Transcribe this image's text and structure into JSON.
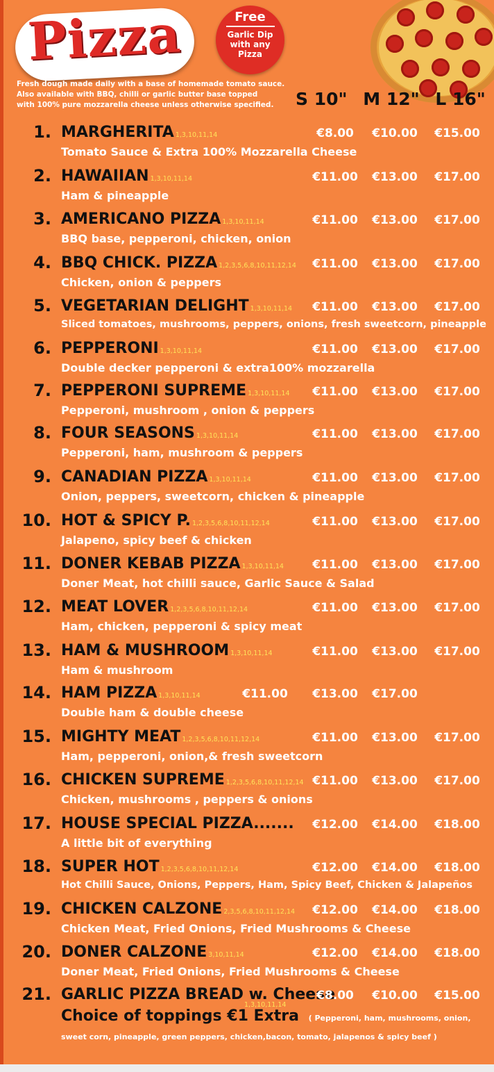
{
  "header": {
    "logo": "Pizza",
    "badge_title": "Free",
    "badge_text": "Garlic Dip with any Pizza",
    "intro_1": "Fresh dough made daily with a base of homemade tomato sauce.",
    "intro_2": "Also available with BBQ, chilli or garlic butter base topped",
    "intro_3": "with 100% pure mozzarella cheese unless otherwise specified.",
    "sizes": [
      "S 10\"",
      "M 12\"",
      "L 16\""
    ]
  },
  "items": [
    {
      "num": "1.",
      "name": "MARGHERITA",
      "allergens": "1,3,10,11,14",
      "prices": [
        "€8.00",
        "€10.00",
        "€15.00"
      ],
      "desc": "Tomato Sauce & Extra 100% Mozzarella Cheese"
    },
    {
      "num": "2.",
      "name": "HAWAIIAN",
      "allergens": "1,3,10,11,14",
      "prices": [
        "€11.00",
        "€13.00",
        "€17.00"
      ],
      "desc": "Ham & pineapple"
    },
    {
      "num": "3.",
      "name": "AMERICANO PIZZA",
      "allergens": "1,3,10,11,14",
      "prices": [
        "€11.00",
        "€13.00",
        "€17.00"
      ],
      "desc": "BBQ base, pepperoni, chicken, onion"
    },
    {
      "num": "4.",
      "name": "BBQ CHICK. PIZZA",
      "allergens": "1,2,3,5,6,8,10,11,12,14",
      "prices": [
        "€11.00",
        "€13.00",
        "€17.00"
      ],
      "desc": "Chicken, onion & peppers"
    },
    {
      "num": "5.",
      "name": "VEGETARIAN DELIGHT",
      "allergens": "1,3,10,11,14",
      "prices": [
        "€11.00",
        "€13.00",
        "€17.00"
      ],
      "desc": "Sliced tomatoes, mushrooms, peppers, onions, fresh sweetcorn, pineapple"
    },
    {
      "num": "6.",
      "name": "PEPPERONI",
      "allergens": "1,3,10,11,14",
      "prices": [
        "€11.00",
        "€13.00",
        "€17.00"
      ],
      "desc": "Double decker pepperoni & extra100% mozzarella"
    },
    {
      "num": "7.",
      "name": "PEPPERONI SUPREME",
      "allergens": "1,3,10,11,14",
      "prices": [
        "€11.00",
        "€13.00",
        "€17.00"
      ],
      "desc": "Pepperoni, mushroom , onion & peppers"
    },
    {
      "num": "8.",
      "name": "FOUR SEASONS",
      "allergens": "1,3,10,11,14",
      "prices": [
        "€11.00",
        "€13.00",
        "€17.00"
      ],
      "desc": "Pepperoni, ham, mushroom & peppers"
    },
    {
      "num": "9.",
      "name": "CANADIAN PIZZA",
      "allergens": "1,3,10,11,14",
      "prices": [
        "€11.00",
        "€13.00",
        "€17.00"
      ],
      "desc": "Onion, peppers, sweetcorn, chicken & pineapple"
    },
    {
      "num": "10.",
      "name": "HOT & SPICY P.",
      "allergens": "1,2,3,5,6,8,10,11,12,14",
      "prices": [
        "€11.00",
        "€13.00",
        "€17.00"
      ],
      "desc": "Jalapeno, spicy beef & chicken"
    },
    {
      "num": "11.",
      "name": "DONER KEBAB PIZZA",
      "allergens": "1,3,10,11,14",
      "prices": [
        "€11.00",
        "€13.00",
        "€17.00"
      ],
      "desc": "Doner Meat, hot chilli sauce, Garlic Sauce & Salad"
    },
    {
      "num": "12.",
      "name": "MEAT LOVER",
      "allergens": "1,2,3,5,6,8,10,11,12,14",
      "prices": [
        "€11.00",
        "€13.00",
        "€17.00"
      ],
      "desc": "Ham, chicken, pepperoni & spicy meat"
    },
    {
      "num": "13.",
      "name": "HAM & MUSHROOM",
      "allergens": "1,3,10,11,14",
      "prices": [
        "€11.00",
        "€13.00",
        "€17.00"
      ],
      "desc": "Ham & mushroom"
    },
    {
      "num": "14.",
      "name": "HAM PIZZA",
      "allergens": "1,3,10,11,14",
      "prices": [
        "€11.00",
        "€13.00",
        "€17.00"
      ],
      "desc": "Double ham & double cheese"
    },
    {
      "num": "15.",
      "name": "MIGHTY MEAT",
      "allergens": "1,2,3,5,6,8,10,11,12,14",
      "prices": [
        "€11.00",
        "€13.00",
        "€17.00"
      ],
      "desc": "Ham, pepperoni, onion,& fresh sweetcorn"
    },
    {
      "num": "16.",
      "name": "CHICKEN SUPREME",
      "allergens": "1,2,3,5,6,8,10,11,12,14",
      "prices": [
        "€11.00",
        "€13.00",
        "€17.00"
      ],
      "desc": "Chicken, mushrooms , peppers & onions"
    },
    {
      "num": "17.",
      "name": "HOUSE SPECIAL PIZZA.......",
      "allergens": "",
      "prices": [
        "€12.00",
        "€14.00",
        "€18.00"
      ],
      "desc": "A little bit of everything"
    },
    {
      "num": "18.",
      "name": "SUPER HOT",
      "allergens": "1,2,3,5,6,8,10,11,12,14",
      "prices": [
        "€12.00",
        "€14.00",
        "€18.00"
      ],
      "desc": "Hot Chilli Sauce, Onions, Peppers, Ham, Spicy Beef, Chicken & Jalapeños"
    },
    {
      "num": "19.",
      "name": "CHICKEN CALZONE",
      "allergens": "2,3,5,6,8,10,11,12,14",
      "prices": [
        "€12.00",
        "€14.00",
        "€18.00"
      ],
      "desc": "Chicken Meat, Fried Onions, Fried Mushrooms & Cheese"
    },
    {
      "num": "20.",
      "name": "DONER CALZONE",
      "allergens": "3,10,11,14",
      "prices": [
        "€12.00",
        "€14.00",
        "€18.00"
      ],
      "desc": "Doner Meat, Fried Onions, Fried Mushrooms & Cheese"
    },
    {
      "num": "21.",
      "name": "GARLIC PIZZA BREAD w. Cheese",
      "allergens": "",
      "prices": [
        "€8.00",
        "€10.00",
        "€15.00"
      ],
      "desc": ""
    }
  ],
  "footer": {
    "allergens": "1,3,10,11,14",
    "toppings": "Choice of toppings €1 Extra",
    "note_1": "( Pepperoni, ham, mushrooms, onion,",
    "note_2": "sweet corn, pineapple, green peppers, chicken,bacon, tomato, jalapenos & spicy beef )"
  }
}
